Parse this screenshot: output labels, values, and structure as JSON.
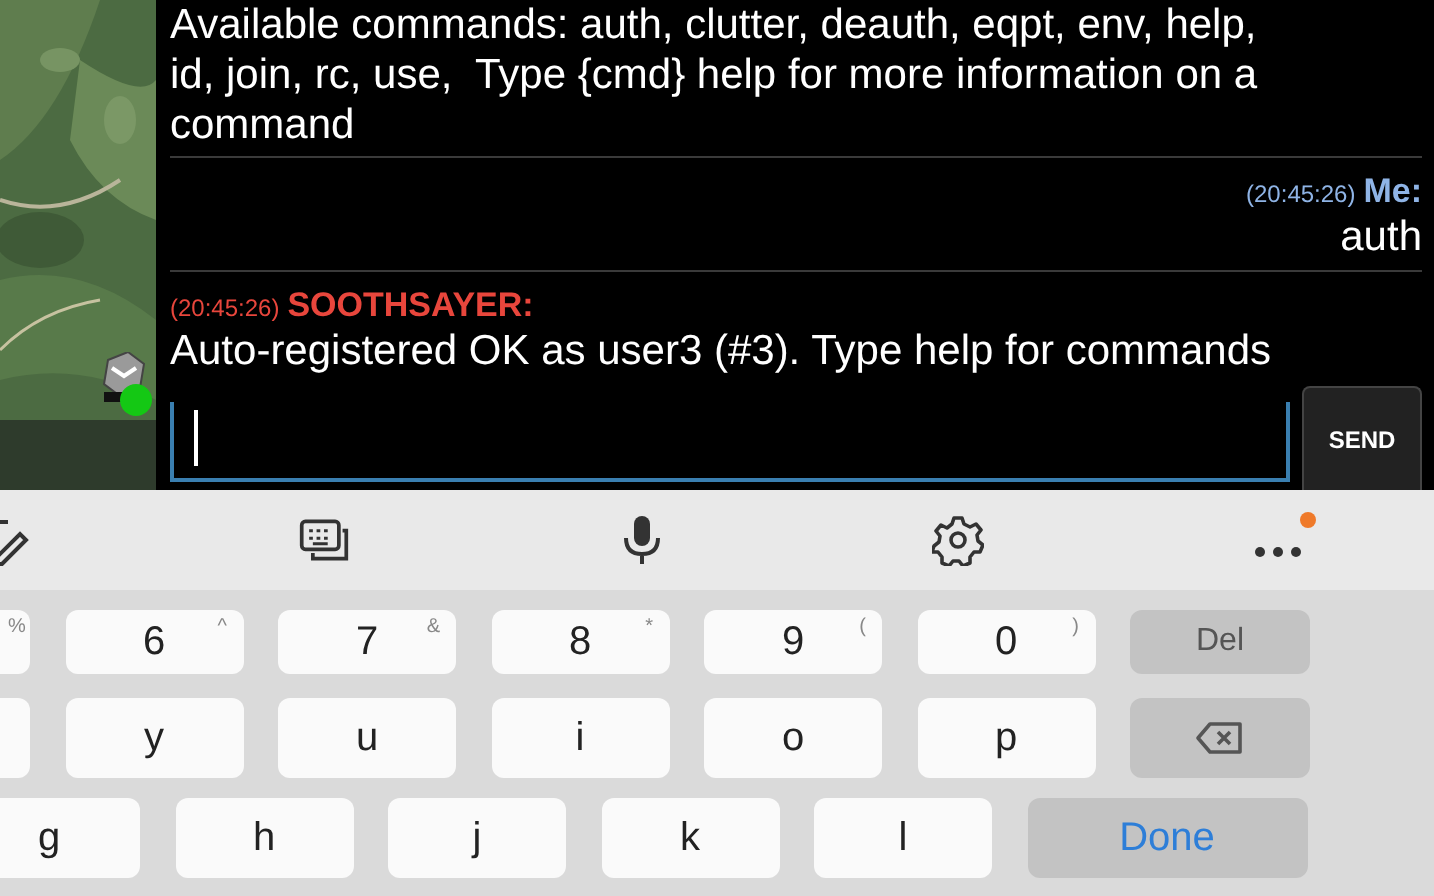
{
  "messages": [
    {
      "kind": "system",
      "lines": [
        "Available commands: auth, clutter, deauth, eqpt, env, help,",
        "id, join, rc, use,  Type {cmd} help for more information on a",
        "command"
      ]
    },
    {
      "kind": "outgoing",
      "time": "(20:45:26)",
      "sender": "Me:",
      "text": "auth"
    },
    {
      "kind": "incoming",
      "time": "(20:45:26)",
      "sender": "SOOTHSAYER:",
      "text": "Auto-registered OK as user3 (#3). Type help for commands"
    }
  ],
  "composer": {
    "send": "SEND"
  },
  "toolbar": {
    "more_badge": true
  },
  "keyboard": {
    "rows": [
      [
        {
          "kind": "partial",
          "hint": "%"
        },
        {
          "kind": "key",
          "label": "6",
          "hint": "^"
        },
        {
          "kind": "key",
          "label": "7",
          "hint": "&"
        },
        {
          "kind": "key",
          "label": "8",
          "hint": "*"
        },
        {
          "kind": "key",
          "label": "9",
          "hint": "("
        },
        {
          "kind": "key",
          "label": "0",
          "hint": ")"
        },
        {
          "kind": "function",
          "label": "Del"
        }
      ],
      [
        {
          "kind": "partial"
        },
        {
          "kind": "key",
          "label": "y"
        },
        {
          "kind": "key",
          "label": "u"
        },
        {
          "kind": "key",
          "label": "i"
        },
        {
          "kind": "key",
          "label": "o"
        },
        {
          "kind": "key",
          "label": "p"
        },
        {
          "kind": "backspace"
        }
      ],
      [
        {
          "kind": "partial",
          "label": "g"
        },
        {
          "kind": "key",
          "label": "h"
        },
        {
          "kind": "key",
          "label": "j"
        },
        {
          "kind": "key",
          "label": "k"
        },
        {
          "kind": "key",
          "label": "l"
        },
        {
          "kind": "action",
          "label": "Done"
        }
      ]
    ]
  }
}
